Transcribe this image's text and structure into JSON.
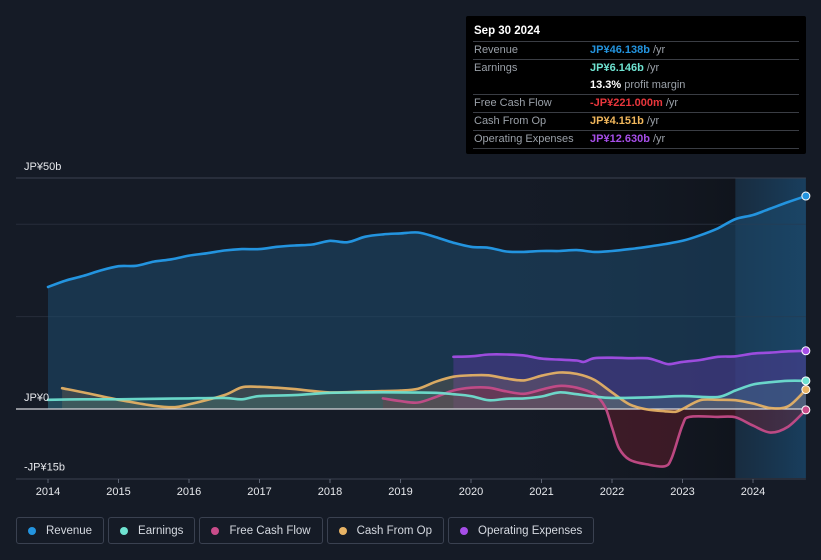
{
  "tooltip": {
    "date": "Sep 30 2024",
    "rows": [
      {
        "label": "Revenue",
        "value": "JP¥46.138b",
        "suffix": " /yr",
        "color": "#2394df"
      },
      {
        "label": "Earnings",
        "value": "JP¥6.146b",
        "suffix": " /yr",
        "color": "#6fe3d1"
      },
      {
        "label": "",
        "value": "13.3%",
        "suffix": " profit margin",
        "color": "#ffffff"
      },
      {
        "label": "Free Cash Flow",
        "value": "-JP¥221.000m",
        "suffix": " /yr",
        "color": "#e8363c"
      },
      {
        "label": "Cash From Op",
        "value": "JP¥4.151b",
        "suffix": " /yr",
        "color": "#f1b75c"
      },
      {
        "label": "Operating Expenses",
        "value": "JP¥12.630b",
        "suffix": " /yr",
        "color": "#a64ee8"
      }
    ]
  },
  "legend": [
    {
      "label": "Revenue",
      "color": "#2394df"
    },
    {
      "label": "Earnings",
      "color": "#6fe3d1"
    },
    {
      "label": "Free Cash Flow",
      "color": "#c94c8a"
    },
    {
      "label": "Cash From Op",
      "color": "#e8b365"
    },
    {
      "label": "Operating Expenses",
      "color": "#a64ee8"
    }
  ],
  "chart_data": {
    "type": "area",
    "title": "",
    "xlabel": "",
    "ylabel": "",
    "currency_unit": "JP¥ billions",
    "ylim": [
      -15,
      50
    ],
    "xlim": [
      2013.97,
      2024.75
    ],
    "y_tick_labels": [
      {
        "value": 50,
        "label": "JP¥50b"
      },
      {
        "value": 0,
        "label": "JP¥0"
      },
      {
        "value": -15,
        "label": "-JP¥15b"
      }
    ],
    "gridlines": [
      50,
      40,
      20,
      0
    ],
    "x_ticks": [
      2014,
      2015,
      2016,
      2017,
      2018,
      2019,
      2020,
      2021,
      2022,
      2023,
      2024
    ],
    "x_tick_labels": [
      "2014",
      "2015",
      "2016",
      "2017",
      "2018",
      "2019",
      "2020",
      "2021",
      "2022",
      "2023",
      "2024"
    ],
    "forecast_shade_start": 2023.75,
    "legend_position": "bottom",
    "series": [
      {
        "name": "Revenue",
        "color": "#2394df",
        "x": [
          2014.0,
          2014.25,
          2014.5,
          2014.75,
          2015.0,
          2015.25,
          2015.5,
          2015.75,
          2016.0,
          2016.25,
          2016.5,
          2016.75,
          2017.0,
          2017.25,
          2017.5,
          2017.75,
          2018.0,
          2018.25,
          2018.5,
          2018.75,
          2019.0,
          2019.25,
          2019.5,
          2019.75,
          2020.0,
          2020.25,
          2020.5,
          2020.75,
          2021.0,
          2021.25,
          2021.5,
          2021.75,
          2022.0,
          2022.25,
          2022.5,
          2022.75,
          2023.0,
          2023.25,
          2023.5,
          2023.75,
          2024.0,
          2024.25,
          2024.5,
          2024.75
        ],
        "values": [
          26.4,
          27.8,
          28.8,
          30.0,
          30.9,
          31.0,
          31.9,
          32.4,
          33.2,
          33.7,
          34.3,
          34.6,
          34.6,
          35.1,
          35.4,
          35.6,
          36.4,
          36.1,
          37.3,
          37.8,
          38.0,
          38.2,
          37.2,
          36.0,
          35.1,
          34.9,
          34.1,
          34.0,
          34.2,
          34.2,
          34.4,
          34.0,
          34.2,
          34.6,
          35.1,
          35.7,
          36.4,
          37.6,
          39.1,
          41.1,
          42.0,
          43.4,
          44.8,
          46.1
        ]
      },
      {
        "name": "Earnings",
        "color": "#6fe3d1",
        "x": [
          2014.0,
          2014.5,
          2015.0,
          2015.5,
          2016.0,
          2016.5,
          2016.75,
          2017.0,
          2017.5,
          2018.0,
          2018.5,
          2019.0,
          2019.5,
          2019.75,
          2020.0,
          2020.25,
          2020.5,
          2020.75,
          2021.0,
          2021.25,
          2021.5,
          2021.75,
          2022.0,
          2022.5,
          2023.0,
          2023.5,
          2023.75,
          2024.0,
          2024.25,
          2024.5,
          2024.75
        ],
        "values": [
          2.0,
          2.1,
          2.1,
          2.2,
          2.3,
          2.4,
          2.1,
          2.8,
          3.0,
          3.5,
          3.6,
          3.6,
          3.5,
          3.2,
          2.8,
          1.9,
          2.2,
          2.3,
          2.7,
          3.6,
          3.2,
          2.7,
          2.4,
          2.5,
          2.8,
          2.6,
          4.0,
          5.3,
          5.8,
          6.1,
          6.1
        ]
      },
      {
        "name": "Free Cash Flow",
        "color": "#c94c8a",
        "x": [
          2018.75,
          2019.0,
          2019.25,
          2019.5,
          2019.75,
          2020.0,
          2020.25,
          2020.5,
          2020.75,
          2021.0,
          2021.25,
          2021.5,
          2021.75,
          2021.9,
          2022.0,
          2022.1,
          2022.25,
          2022.5,
          2022.75,
          2022.85,
          2023.0,
          2023.1,
          2023.5,
          2023.75,
          2024.0,
          2024.25,
          2024.5,
          2024.75
        ],
        "values": [
          2.3,
          1.7,
          1.4,
          2.6,
          4.0,
          4.6,
          4.6,
          3.8,
          3.3,
          4.2,
          5.0,
          4.6,
          3.2,
          0.5,
          -4.0,
          -8.5,
          -11.0,
          -12.0,
          -12.4,
          -10.5,
          -3.5,
          -1.7,
          -1.7,
          -1.8,
          -3.6,
          -5.1,
          -3.8,
          -0.2
        ]
      },
      {
        "name": "Cash From Op",
        "color": "#e8b365",
        "x": [
          2014.2,
          2014.5,
          2015.0,
          2015.5,
          2015.8,
          2016.0,
          2016.5,
          2016.75,
          2017.0,
          2017.25,
          2017.5,
          2018.0,
          2018.5,
          2019.0,
          2019.25,
          2019.5,
          2019.75,
          2020.0,
          2020.25,
          2020.5,
          2020.75,
          2021.0,
          2021.25,
          2021.5,
          2021.75,
          2022.0,
          2022.25,
          2022.5,
          2022.75,
          2022.9,
          2023.0,
          2023.25,
          2023.5,
          2023.75,
          2024.0,
          2024.25,
          2024.5,
          2024.75
        ],
        "values": [
          4.5,
          3.6,
          2.0,
          0.7,
          0.4,
          1.0,
          3.0,
          4.7,
          4.8,
          4.6,
          4.3,
          3.6,
          3.8,
          4.0,
          4.4,
          5.9,
          7.0,
          7.3,
          7.3,
          6.6,
          6.2,
          7.2,
          7.9,
          7.6,
          6.3,
          3.6,
          1.0,
          -0.1,
          -0.5,
          -0.6,
          0.0,
          1.9,
          2.0,
          1.9,
          1.2,
          0.2,
          0.6,
          4.2
        ]
      },
      {
        "name": "Operating Expenses",
        "color": "#a64ee8",
        "x": [
          2019.75,
          2020.0,
          2020.25,
          2020.5,
          2020.75,
          2021.0,
          2021.25,
          2021.5,
          2021.6,
          2021.75,
          2022.0,
          2022.25,
          2022.5,
          2022.65,
          2022.8,
          2023.0,
          2023.25,
          2023.5,
          2023.75,
          2024.0,
          2024.25,
          2024.5,
          2024.75
        ],
        "values": [
          11.3,
          11.4,
          11.8,
          11.8,
          11.6,
          10.9,
          10.7,
          10.5,
          10.2,
          11.0,
          11.1,
          11.0,
          11.0,
          10.4,
          9.7,
          10.2,
          10.6,
          11.3,
          11.4,
          12.0,
          12.2,
          12.5,
          12.6
        ]
      }
    ]
  }
}
